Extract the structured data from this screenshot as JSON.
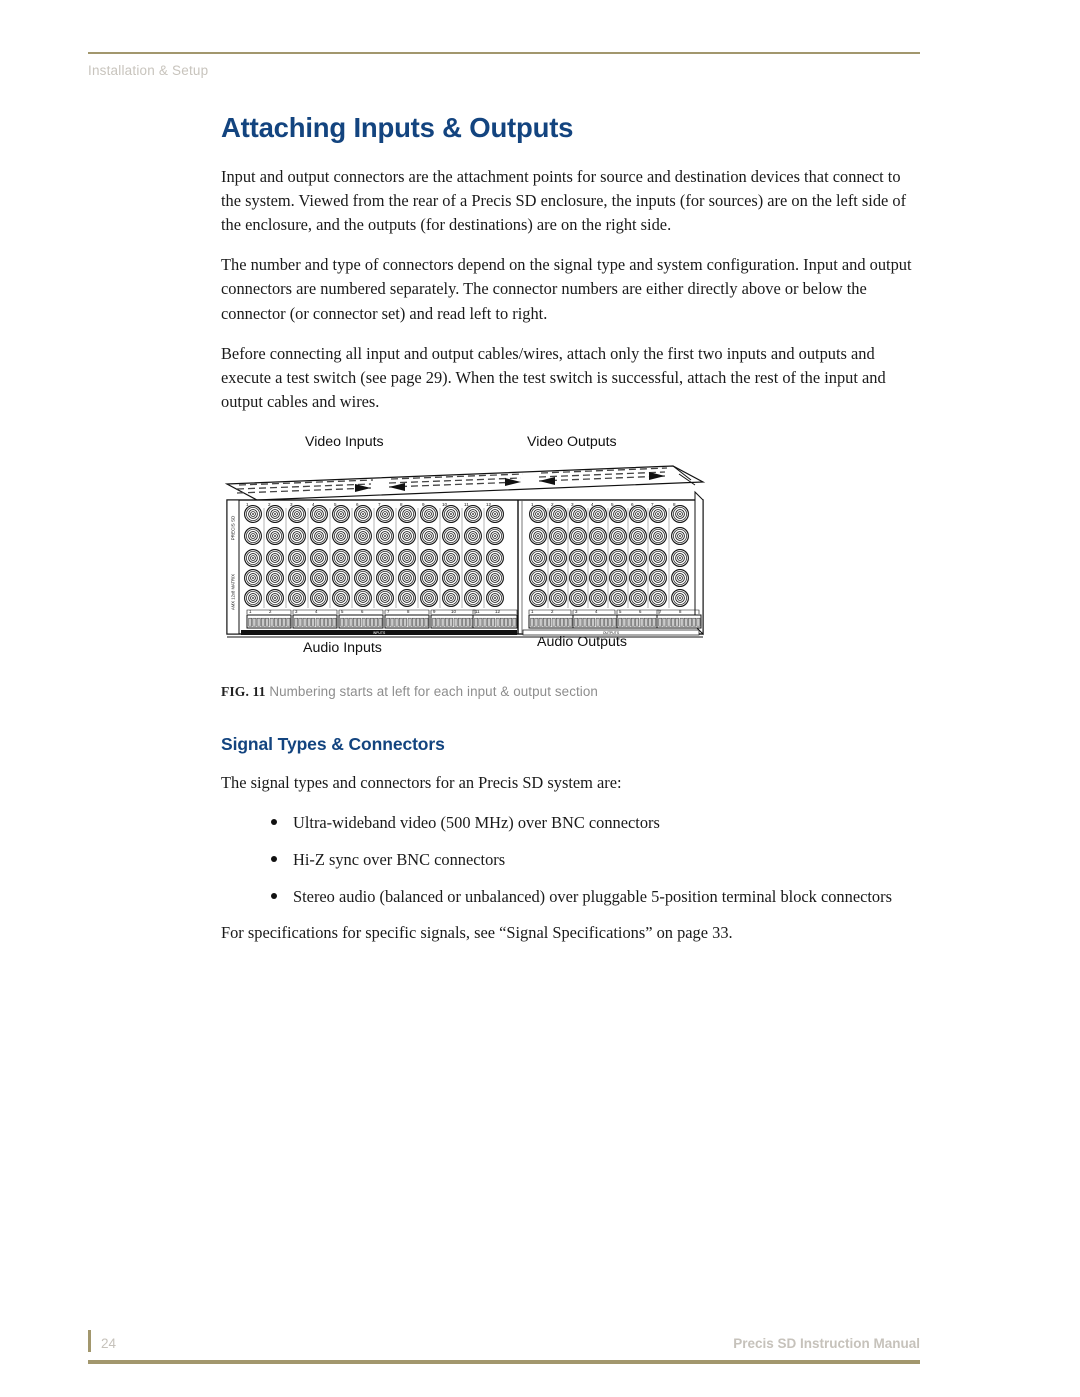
{
  "header": {
    "breadcrumb": "Installation & Setup",
    "rule_color": "#a2976d",
    "text_color": "#c8c4bd"
  },
  "chapter": {
    "title": "Attaching Inputs & Outputs",
    "title_color": "#13447f"
  },
  "paragraphs": {
    "p1": "Input and output connectors are the attachment points for source and destination devices that connect to the system. Viewed from the rear of a Precis SD enclosure, the inputs (for sources) are on the left side of the enclosure, and the outputs (for destinations) are on the right side.",
    "p2": "The number and type of connectors depend on the signal type and system configuration. Input and output connectors are numbered separately. The connector numbers are either directly above or below the connector (or connector set) and read left to right.",
    "p3": "Before connecting all input and output cables/wires, attach only the first two inputs and outputs and execute a test switch (see page 29). When the test switch is successful, attach the rest of the input and output cables and wires."
  },
  "figure": {
    "labels": {
      "video_inputs": "Video Inputs",
      "video_outputs": "Video Outputs",
      "audio_inputs": "Audio Inputs",
      "audio_outputs": "Audio Outputs"
    },
    "panel": {
      "side_text_top": "PRECIS SD",
      "side_text_bottom": "AMX",
      "input_section_label": "INPUTS",
      "output_section_label": "OUTPUTS",
      "video_input_numbers": [
        1,
        2,
        3,
        4,
        5,
        6,
        7,
        8,
        9,
        10,
        11,
        12
      ],
      "video_output_numbers": [
        1,
        2,
        3,
        4,
        5,
        6,
        7,
        8
      ],
      "video_rows": 5,
      "audio_input_numbers": [
        1,
        2,
        3,
        4,
        5,
        6,
        7,
        8,
        9,
        10,
        11,
        12
      ],
      "audio_output_numbers": [
        1,
        2,
        3,
        4,
        5,
        6,
        7,
        8
      ],
      "audio_input_blocks": 6,
      "audio_output_blocks": 4,
      "terminal_positions_per_block": 10
    },
    "caption_number": "FIG. 11",
    "caption_text": "Numbering starts at left for each input & output section"
  },
  "section": {
    "title": "Signal Types & Connectors",
    "intro": "The signal types and connectors for an Precis SD system are:",
    "bullets": [
      "Ultra-wideband video (500 MHz) over BNC connectors",
      "Hi-Z sync over BNC connectors",
      "Stereo audio (balanced or unbalanced) over pluggable 5-position terminal block connectors"
    ],
    "closing": "For specifications for specific signals, see “Signal Specifications” on page 33."
  },
  "footer": {
    "page_number": "24",
    "manual_title": "Precis SD Instruction Manual",
    "rule_color": "#a2976d"
  }
}
